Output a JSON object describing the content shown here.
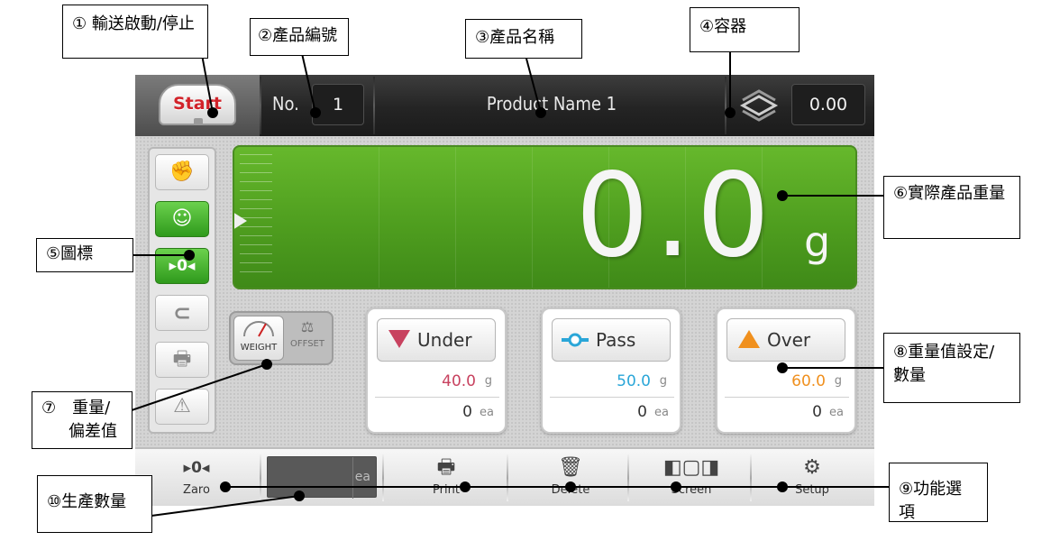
{
  "topbar": {
    "start_label": "Start",
    "no_label": "No.",
    "product_no": "1",
    "product_name": "Product Name 1",
    "container_icon": "container-stack-icon",
    "tare_value": "0.00"
  },
  "weight": {
    "value": "0.0",
    "unit": "g"
  },
  "side_icons": [
    {
      "name": "hand-stop-icon",
      "active": false
    },
    {
      "name": "smile-face-icon",
      "active": true
    },
    {
      "name": "zero-arrows-icon",
      "active": true
    },
    {
      "name": "magnet-icon",
      "active": false
    },
    {
      "name": "printer-icon",
      "active": false
    },
    {
      "name": "warning-triangle-icon",
      "active": false
    }
  ],
  "toggle": {
    "weight_label": "WEIGHT",
    "offset_label": "OFFSET",
    "selected": "WEIGHT"
  },
  "cards": {
    "under": {
      "label": "Under",
      "value": "40.0",
      "unit": "g",
      "count": "0",
      "count_unit": "ea",
      "color": "#c8425f"
    },
    "pass": {
      "label": "Pass",
      "value": "50.0",
      "unit": "g",
      "count": "0",
      "count_unit": "ea",
      "color": "#2aa6d8"
    },
    "over": {
      "label": "Over",
      "value": "60.0",
      "unit": "g",
      "count": "0",
      "count_unit": "ea",
      "color": "#f0901e"
    }
  },
  "bottombar": {
    "zaro_label": "Zaro",
    "counter_unit": "ea",
    "print_label": "Print",
    "delete_label": "Delete",
    "screen_label": "Screen",
    "setup_label": "Setup"
  },
  "callouts": {
    "c1": "① 輸送啟動/停止",
    "c2": "②產品編號",
    "c3": "③產品名稱",
    "c4": "④容器",
    "c5": "⑤圖標",
    "c6": "⑥實際產品重量",
    "c7_line1": "⑦　重量/",
    "c7_line2": "偏差值",
    "c8": "⑧重量值設定/數量",
    "c9": "⑨功能選項",
    "c10": "⑩生產數量"
  },
  "colors": {
    "green_panel": "#5aac25",
    "start_red": "#d2232a"
  }
}
